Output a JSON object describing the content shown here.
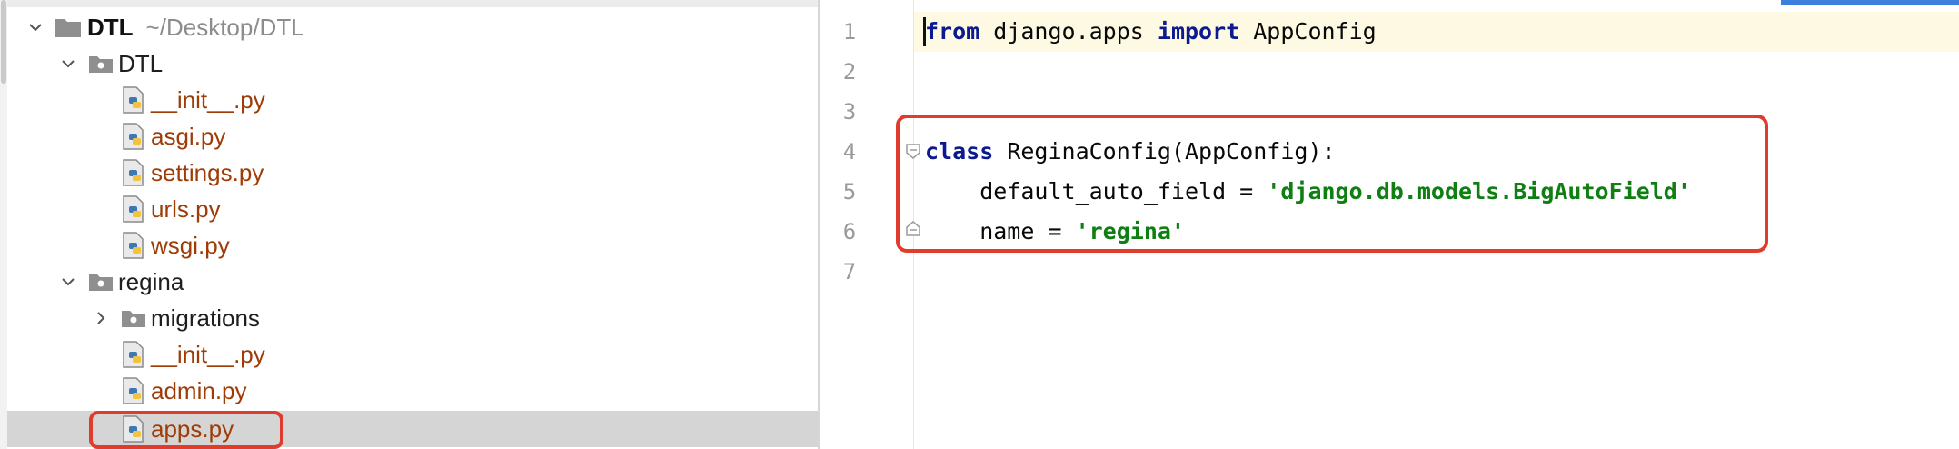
{
  "project_tree": {
    "root": {
      "name": "DTL",
      "path": "~/Desktop/DTL"
    },
    "rows": [
      {
        "kind": "folder",
        "label": "DTL"
      },
      {
        "kind": "file",
        "label": "__init__.py"
      },
      {
        "kind": "file",
        "label": "asgi.py"
      },
      {
        "kind": "file",
        "label": "settings.py"
      },
      {
        "kind": "file",
        "label": "urls.py"
      },
      {
        "kind": "file",
        "label": "wsgi.py"
      },
      {
        "kind": "folder",
        "label": "regina"
      },
      {
        "kind": "folder",
        "label": "migrations"
      },
      {
        "kind": "file",
        "label": "__init__.py"
      },
      {
        "kind": "file",
        "label": "admin.py"
      },
      {
        "kind": "file",
        "label": "apps.py",
        "selected": true
      }
    ]
  },
  "editor": {
    "line_numbers": [
      "1",
      "2",
      "3",
      "4",
      "5",
      "6",
      "7"
    ],
    "lines": [
      [
        {
          "t": "from",
          "c": "kw"
        },
        {
          "t": " django.apps ",
          "c": ""
        },
        {
          "t": "import",
          "c": "kw"
        },
        {
          "t": " AppConfig",
          "c": ""
        }
      ],
      [],
      [],
      [
        {
          "t": "class",
          "c": "kw"
        },
        {
          "t": " ReginaConfig(AppConfig):",
          "c": ""
        }
      ],
      [
        {
          "t": "    default_auto_field = ",
          "c": ""
        },
        {
          "t": "'django.db.models.BigAutoField'",
          "c": "str"
        }
      ],
      [
        {
          "t": "    name = ",
          "c": ""
        },
        {
          "t": "'regina'",
          "c": "str"
        }
      ],
      []
    ]
  },
  "colors": {
    "highlight_box": "#e03c2d",
    "keyword": "#0b1a8f",
    "string": "#0f7f12",
    "py_file": "#9e3b06",
    "selection": "#d5d5d5",
    "current_line": "#fdf9e2"
  },
  "icons": {
    "expanded": "chevron-down-icon",
    "collapsed": "chevron-right-icon",
    "folder": "folder-icon",
    "package": "package-folder-icon",
    "python_file": "python-file-icon"
  }
}
